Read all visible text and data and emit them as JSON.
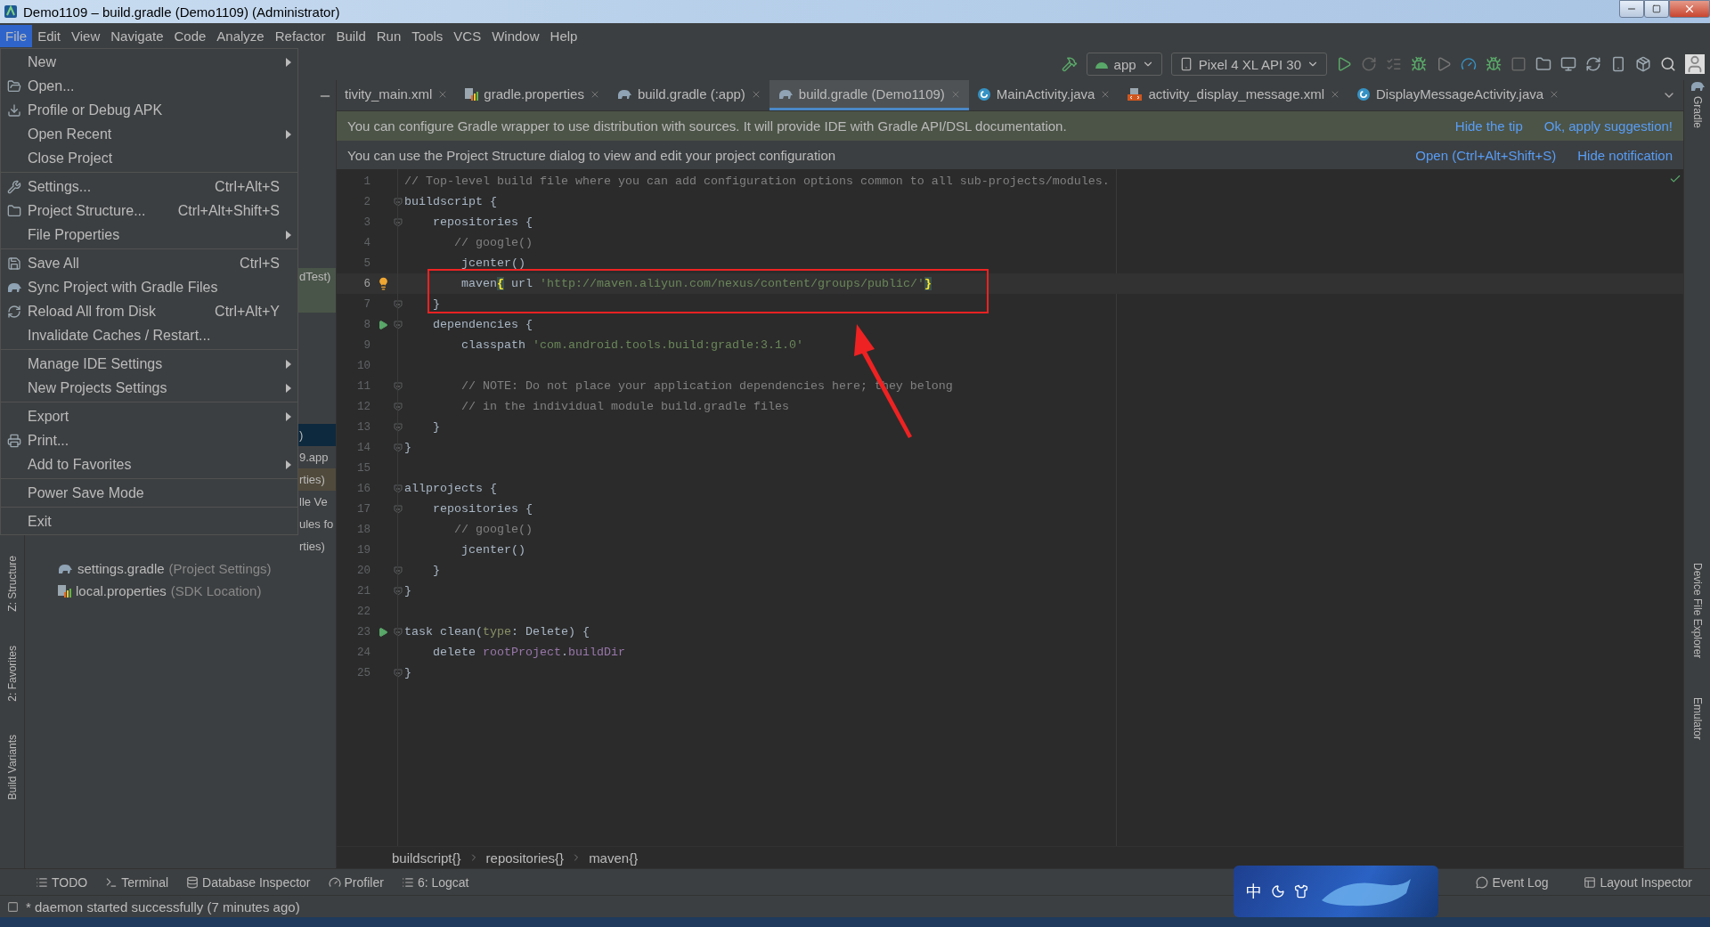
{
  "window": {
    "title": "Demo1109 – build.gradle (Demo1109) (Administrator)"
  },
  "menu_bar": [
    {
      "label": "File",
      "selected": true
    },
    {
      "label": "Edit",
      "selected": false
    },
    {
      "label": "View",
      "selected": false
    },
    {
      "label": "Navigate",
      "selected": false
    },
    {
      "label": "Code",
      "selected": false
    },
    {
      "label": "Analyze",
      "selected": false
    },
    {
      "label": "Refactor",
      "selected": false
    },
    {
      "label": "Build",
      "selected": false
    },
    {
      "label": "Run",
      "selected": false
    },
    {
      "label": "Tools",
      "selected": false
    },
    {
      "label": "VCS",
      "selected": false
    },
    {
      "label": "Window",
      "selected": false
    },
    {
      "label": "Help",
      "selected": false
    }
  ],
  "toolbar": {
    "run_configuration": "app",
    "device": "Pixel 4 XL API 30"
  },
  "file_menu": [
    [
      {
        "label": "New",
        "submenu": true
      },
      {
        "label": "Open..."
      },
      {
        "label": "Profile or Debug APK"
      },
      {
        "label": "Open Recent",
        "submenu": true
      },
      {
        "label": "Close Project"
      }
    ],
    [
      {
        "label": "Settings...",
        "shortcut": "Ctrl+Alt+S"
      },
      {
        "label": "Project Structure...",
        "shortcut": "Ctrl+Alt+Shift+S"
      },
      {
        "label": "File Properties",
        "submenu": true
      }
    ],
    [
      {
        "label": "Save All",
        "shortcut": "Ctrl+S"
      },
      {
        "label": "Sync Project with Gradle Files"
      },
      {
        "label": "Reload All from Disk",
        "shortcut": "Ctrl+Alt+Y"
      },
      {
        "label": "Invalidate Caches / Restart..."
      }
    ],
    [
      {
        "label": "Manage IDE Settings",
        "submenu": true
      },
      {
        "label": "New Projects Settings",
        "submenu": true
      }
    ],
    [
      {
        "label": "Export",
        "submenu": true
      },
      {
        "label": "Print..."
      },
      {
        "label": "Add to Favorites",
        "submenu": true
      }
    ],
    [
      {
        "label": "Power Save Mode"
      }
    ],
    [
      {
        "label": "Exit"
      }
    ]
  ],
  "project_tree": [
    {
      "text": "dTest)",
      "selected": false,
      "color": "#4a5549"
    },
    {
      "text": ")",
      "selected": true
    },
    {
      "text": "9.app",
      "selected": false
    },
    {
      "text": "rties)",
      "selected": false,
      "color": "#504a3c"
    },
    {
      "text": "lle Ve",
      "selected": false
    },
    {
      "text": "ules fo",
      "selected": false
    },
    {
      "text": "rties)",
      "selected": false
    },
    {
      "text": "settings.gradle",
      "detail": "(Project Settings)",
      "kind": "gradle",
      "selected": false
    },
    {
      "text": "local.properties",
      "detail": "(SDK Location)",
      "kind": "properties",
      "selected": false
    }
  ],
  "tabs": [
    {
      "label": "tivity_main.xml",
      "kind": "layout",
      "selected": false
    },
    {
      "label": "gradle.properties",
      "kind": "properties",
      "selected": false
    },
    {
      "label": "build.gradle (:app)",
      "kind": "gradle",
      "selected": false
    },
    {
      "label": "build.gradle (Demo1109)",
      "kind": "gradle",
      "selected": true
    },
    {
      "label": "MainActivity.java",
      "kind": "class",
      "selected": false
    },
    {
      "label": "activity_display_message.xml",
      "kind": "xml",
      "selected": false
    },
    {
      "label": "DisplayMessageActivity.java",
      "kind": "class",
      "selected": false
    }
  ],
  "notifications": [
    {
      "kind": "tip",
      "text": "You can configure Gradle wrapper to use distribution with sources. It will provide IDE with Gradle API/DSL documentation.",
      "links": [
        "Hide the tip",
        "Ok, apply suggestion!"
      ]
    },
    {
      "kind": "info",
      "text": "You can use the Project Structure dialog to view and edit your project configuration",
      "links": [
        "Open (Ctrl+Alt+Shift+S)",
        "Hide notification"
      ]
    }
  ],
  "code_lines": [
    {
      "number": "1",
      "segments": [
        {
          "kind": "comment",
          "text": "// Top-level build file where you can add configuration options common to all sub-projects/modules."
        }
      ]
    },
    {
      "number": "2",
      "fold": true,
      "segments": [
        {
          "kind": "plain",
          "text": "buildscript {"
        }
      ]
    },
    {
      "number": "3",
      "fold": true,
      "segments": [
        {
          "kind": "plain",
          "text": "    repositories {"
        }
      ]
    },
    {
      "number": "4",
      "segments": [
        {
          "kind": "comment",
          "text": "       // google()"
        }
      ]
    },
    {
      "number": "5",
      "segments": [
        {
          "kind": "plain",
          "text": "        jcenter()"
        }
      ]
    },
    {
      "number": "6",
      "current": true,
      "bulb": true,
      "segments": [
        {
          "kind": "plain",
          "text": "        maven"
        },
        {
          "kind": "brace",
          "text": "{"
        },
        {
          "kind": "plain",
          "text": " url "
        },
        {
          "kind": "string",
          "text": "'http://maven.aliyun.com/nexus/content/groups/public/'"
        },
        {
          "kind": "brace",
          "text": "}"
        }
      ]
    },
    {
      "number": "7",
      "fold": true,
      "segments": [
        {
          "kind": "plain",
          "text": "    }"
        }
      ]
    },
    {
      "number": "8",
      "fold": true,
      "run": true,
      "segments": [
        {
          "kind": "plain",
          "text": "    dependencies {"
        }
      ]
    },
    {
      "number": "9",
      "segments": [
        {
          "kind": "plain",
          "text": "        classpath "
        },
        {
          "kind": "string",
          "text": "'com.android.tools.build:gradle:3.1.0'"
        }
      ]
    },
    {
      "number": "10"
    },
    {
      "number": "11",
      "fold": true,
      "segments": [
        {
          "kind": "comment",
          "text": "        // NOTE: Do not place your application dependencies here; they belong"
        }
      ]
    },
    {
      "number": "12",
      "fold": true,
      "segments": [
        {
          "kind": "comment",
          "text": "        // in the individual module build.gradle files"
        }
      ]
    },
    {
      "number": "13",
      "fold": true,
      "segments": [
        {
          "kind": "plain",
          "text": "    }"
        }
      ]
    },
    {
      "number": "14",
      "fold": true,
      "segments": [
        {
          "kind": "plain",
          "text": "}"
        }
      ]
    },
    {
      "number": "15"
    },
    {
      "number": "16",
      "fold": true,
      "segments": [
        {
          "kind": "plain",
          "text": "allprojects {"
        }
      ]
    },
    {
      "number": "17",
      "fold": true,
      "segments": [
        {
          "kind": "plain",
          "text": "    repositories {"
        }
      ]
    },
    {
      "number": "18",
      "segments": [
        {
          "kind": "comment",
          "text": "       // google()"
        }
      ]
    },
    {
      "number": "19",
      "segments": [
        {
          "kind": "plain",
          "text": "        jcenter()"
        }
      ]
    },
    {
      "number": "20",
      "fold": true,
      "segments": [
        {
          "kind": "plain",
          "text": "    }"
        }
      ]
    },
    {
      "number": "21",
      "fold": true,
      "segments": [
        {
          "kind": "plain",
          "text": "}"
        }
      ]
    },
    {
      "number": "22"
    },
    {
      "number": "23",
      "fold": true,
      "run": true,
      "segments": [
        {
          "kind": "plain",
          "text": "task clean("
        },
        {
          "kind": "param",
          "text": "type"
        },
        {
          "kind": "plain",
          "text": ": Delete) {"
        }
      ]
    },
    {
      "number": "24",
      "segments": [
        {
          "kind": "plain",
          "text": "    delete "
        },
        {
          "kind": "field",
          "text": "rootProject"
        },
        {
          "kind": "plain",
          "text": "."
        },
        {
          "kind": "field",
          "text": "buildDir"
        }
      ]
    },
    {
      "number": "25",
      "fold": true,
      "segments": [
        {
          "kind": "plain",
          "text": "}"
        }
      ]
    }
  ],
  "breadcrumb": [
    "buildscript{}",
    "repositories{}",
    "maven{}"
  ],
  "left_tool_windows": [
    "Z: Structure",
    "2: Favorites",
    "Build Variants"
  ],
  "right_tool_windows": [
    "Gradle",
    "Device File Explorer",
    "Emulator"
  ],
  "bottom_tool_windows": [
    {
      "label": "TODO",
      "kind": "todo"
    },
    {
      "label": "Terminal",
      "kind": "terminal"
    },
    {
      "label": "Database Inspector",
      "kind": "database"
    },
    {
      "label": "Profiler",
      "kind": "profiler"
    },
    {
      "label": "6: Logcat",
      "kind": "logcat"
    }
  ],
  "bottom_right_tool_windows": [
    {
      "label": "Event Log",
      "kind": "log"
    },
    {
      "label": "Layout Inspector",
      "kind": "inspector"
    }
  ],
  "ime_toolbar": {
    "label": "中"
  },
  "status_bar": {
    "message": "* daemon started successfully (7 minutes ago)"
  }
}
